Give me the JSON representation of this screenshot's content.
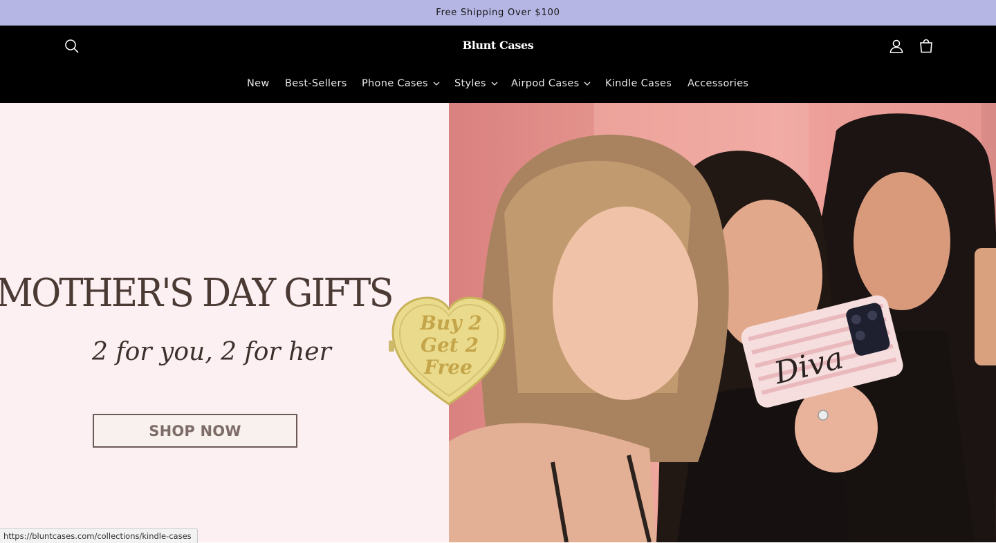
{
  "announcement": {
    "text": "Free Shipping Over $100"
  },
  "header": {
    "logo": "Blunt Cases",
    "icons": {
      "search": "search-icon",
      "account": "account-icon",
      "cart": "cart-icon"
    }
  },
  "nav": {
    "items": [
      {
        "label": "New",
        "has_dropdown": false
      },
      {
        "label": "Best-Sellers",
        "has_dropdown": false
      },
      {
        "label": "Phone Cases",
        "has_dropdown": true
      },
      {
        "label": "Styles",
        "has_dropdown": true
      },
      {
        "label": "Airpod Cases",
        "has_dropdown": true
      },
      {
        "label": "Kindle Cases",
        "has_dropdown": false
      },
      {
        "label": "Accessories",
        "has_dropdown": false
      }
    ]
  },
  "hero": {
    "title": "MOTHER'S DAY GIFTS",
    "subtitle": "2 for you, 2 for her",
    "cta": "SHOP NOW",
    "badge": {
      "line1": "Buy 2",
      "line2": "Get 2",
      "line3": "Free"
    },
    "phone_case_text": "Diva"
  },
  "status_bar": {
    "url": "https://bluntcases.com/collections/kindle-cases"
  },
  "colors": {
    "announcement_bg": "#b5b6e4",
    "header_bg": "#000000",
    "hero_left_bg": "#fcf0f3",
    "hero_title": "#4b3a34",
    "badge_gold": "#e9dc8e"
  }
}
